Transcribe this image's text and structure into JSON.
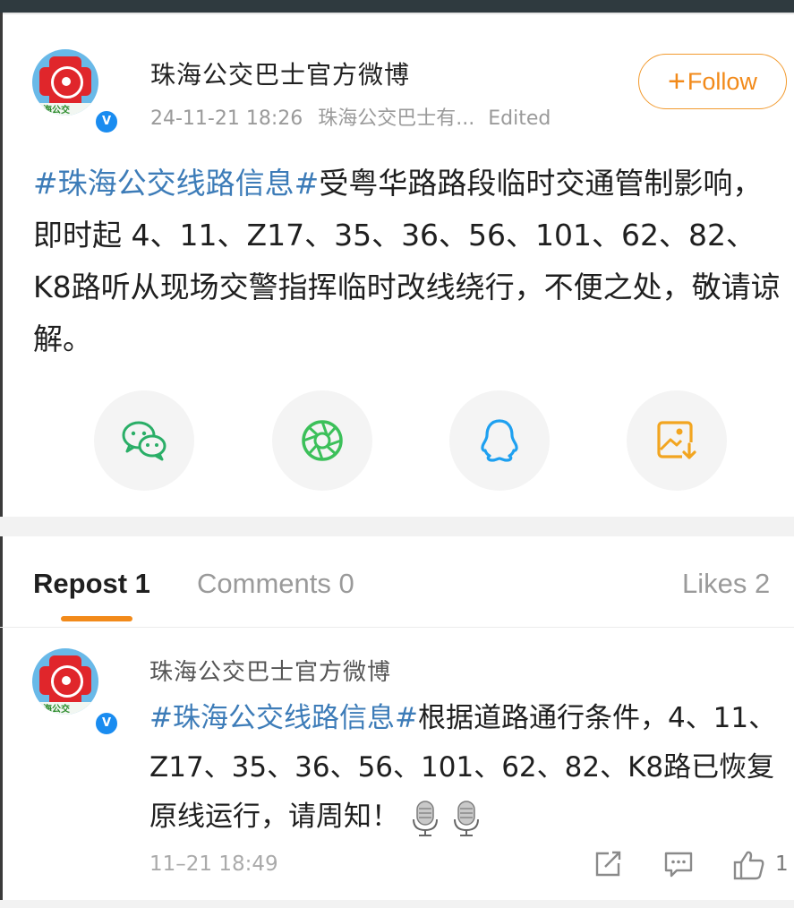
{
  "post": {
    "author": "珠海公交巴士官方微博",
    "avatar_badge": "V",
    "avatar_strip_text": "海公交",
    "time": "24-11-21 18:26",
    "source": "珠海公交巴士有...",
    "edited": "Edited",
    "follow_label": "Follow",
    "follow_plus": "+",
    "hashtag": "#珠海公交线路信息#",
    "body": "受粤华路路段临时交通管制影响，即时起 4、11、Z17、35、36、56、101、62、82、K8路听从现场交警指挥临时改线绕行，不便之处，敬请谅解。"
  },
  "share": [
    {
      "name": "wechat-icon",
      "color": "#2aae67"
    },
    {
      "name": "moments-icon",
      "color": "#3cc05a"
    },
    {
      "name": "qq-icon",
      "color": "#1ea0f0"
    },
    {
      "name": "save-image-icon",
      "color": "#f2a520"
    }
  ],
  "tabs": {
    "repost": "Repost 1",
    "comments": "Comments 0",
    "likes": "Likes 2"
  },
  "repost": {
    "author": "珠海公交巴士官方微博",
    "hashtag": "#珠海公交线路信息#",
    "body": "根据道路通行条件，4、11、Z17、35、36、56、101、62、82、K8路已恢复原线运行，请周知！",
    "time": "11–21 18:49",
    "like_count": "1"
  },
  "colors": {
    "accent": "#f28a1a",
    "link": "#3d7cb8",
    "verified": "#1a8cf0"
  }
}
